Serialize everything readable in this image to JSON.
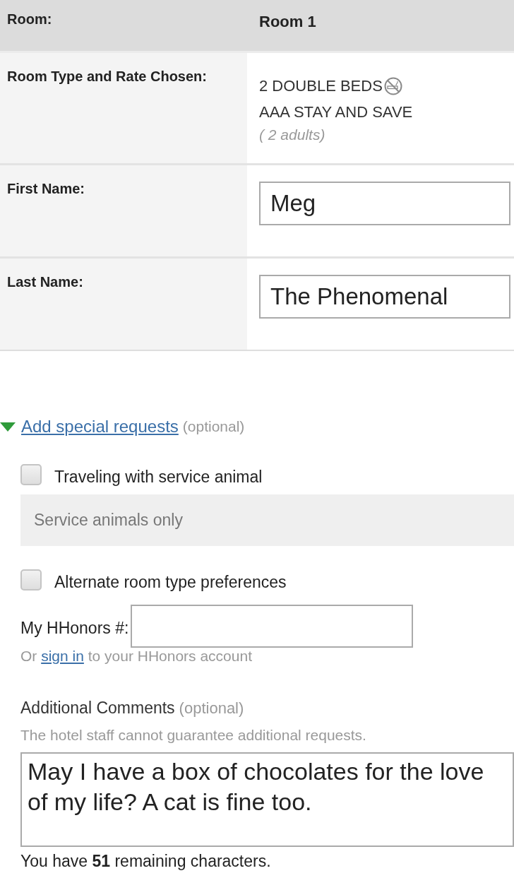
{
  "summary": {
    "rows": [
      {
        "kind": "header",
        "label": "Room:",
        "value": "Room 1"
      },
      {
        "kind": "details",
        "label": "Room Type and Rate Chosen:",
        "lines": [
          "2 DOUBLE BEDS",
          "AAA STAY AND SAVE"
        ],
        "guests": "( 2 adults)"
      },
      {
        "kind": "input",
        "label": "First Name:",
        "value": "Meg"
      },
      {
        "kind": "input",
        "label": "Last Name:",
        "value": "The Phenomenal"
      }
    ]
  },
  "special_requests": {
    "link": "Add special requests",
    "note": "(optional)",
    "expanded": true,
    "options": [
      {
        "kind": "checkbox",
        "label": "Traveling with service animal",
        "checked": false,
        "detail": "Service animals only"
      },
      {
        "kind": "checkbox",
        "label": "Alternate room type preferences",
        "checked": false
      }
    ],
    "honors": {
      "label": "My HHonors #:",
      "hint": {
        "before": "Or",
        "link": "sign in",
        "after": "to your HHonors account"
      }
    },
    "comments": {
      "label": "Additional Comments",
      "note": "(optional)",
      "disclaimer": "The hotel staff cannot guarantee additional requests.",
      "value": "May I have a box of chocolates for the love of my life? A cat is fine too.",
      "counter": "You have **51** remaining characters."
    }
  }
}
